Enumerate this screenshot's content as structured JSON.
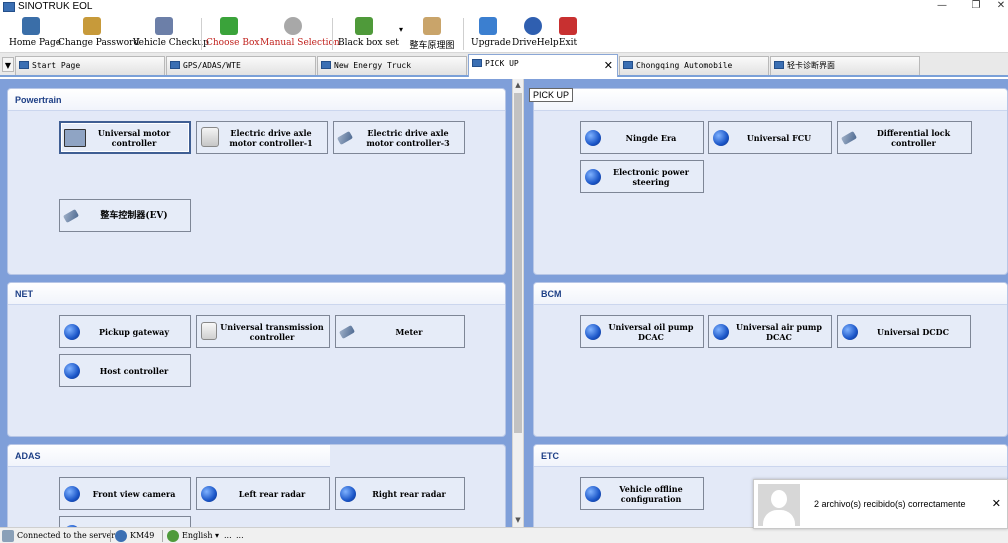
{
  "window": {
    "title": "SINOTRUK EOL",
    "minimize": "—",
    "restore": "❐",
    "close": "✕"
  },
  "toolbar": {
    "items": [
      {
        "label": "Home Page",
        "color": "#3a6ea8"
      },
      {
        "label": "Change Password",
        "color": "#c79a3a"
      },
      {
        "label": "Vehicle Checkup",
        "color": "#6c7fa8"
      },
      {
        "label": "Choose Box",
        "color": "#3aa33a"
      },
      {
        "label": "Manual Selection",
        "color": "#a8a8a8"
      },
      {
        "label": "Black box set",
        "color": "#4f9a3a"
      },
      {
        "label": "整车原理图",
        "color": "#c9a46a"
      },
      {
        "label": "Upgrade",
        "color": "#3b7fd0"
      },
      {
        "label": "DriveHelp",
        "color": "#2f5fb0"
      },
      {
        "label": "Exit",
        "color": "#c83030"
      }
    ],
    "dropdown_caret": "▾"
  },
  "tabs": {
    "scroll_arrow": "▼",
    "items": [
      {
        "label": "Start Page"
      },
      {
        "label": "GPS/ADAS/WTE"
      },
      {
        "label": "New Energy Truck"
      },
      {
        "label": "PICK UP",
        "close": "✕"
      },
      {
        "label": "Chongqing Automobile"
      },
      {
        "label": "轻卡诊断界面"
      }
    ]
  },
  "tooltip": "PICK UP",
  "panels": {
    "powertrain": {
      "title": "Powertrain",
      "buttons": [
        "Universal motor controller",
        "Electric drive axle motor controller-1",
        "Electric drive axle motor controller-3",
        "整车控制器(EV)"
      ]
    },
    "chassis": {
      "title": "",
      "buttons": [
        "Ningde Era",
        "Universal FCU",
        "Differential lock controller",
        "Electronic power steering"
      ]
    },
    "net": {
      "title": "NET",
      "buttons": [
        "Pickup gateway",
        "Universal transmission controller",
        "Meter",
        "Host controller"
      ]
    },
    "bcm": {
      "title": "BCM",
      "buttons": [
        "Universal oil pump DCAC",
        "Universal air pump DCAC",
        "Universal DCDC"
      ]
    },
    "adas": {
      "title": "ADAS",
      "buttons": [
        "Front view camera",
        "Left rear radar",
        "Right rear radar"
      ]
    },
    "etc": {
      "title": "ETC",
      "buttons": [
        "Vehicle offline configuration"
      ]
    }
  },
  "scrollbar": {
    "up": "▲",
    "down": "▼"
  },
  "notification": {
    "message": "2 archivo(s) recibido(s) correctamente",
    "close": "✕"
  },
  "status": {
    "connection": "Connected to the server",
    "model": "KM49",
    "language": "English",
    "language_caret": "▾",
    "ellipsis1": "...",
    "ellipsis2": "..."
  }
}
